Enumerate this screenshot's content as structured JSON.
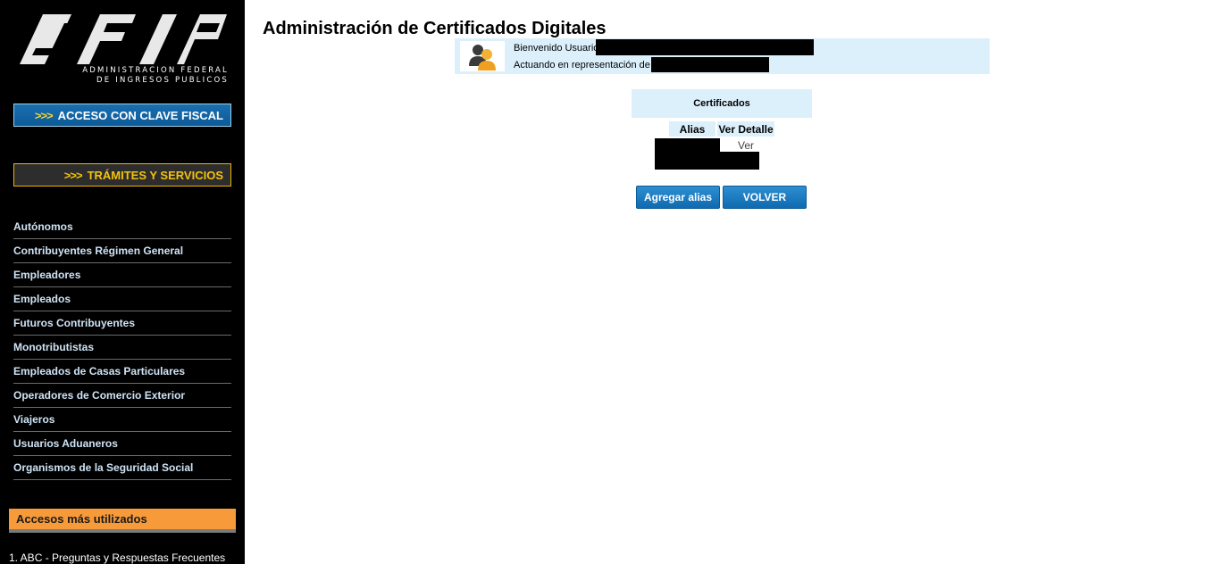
{
  "sidebar": {
    "logo": {
      "text": "AFIP",
      "subtitle_line1": "ADMINISTRACION FEDERAL",
      "subtitle_line2": "DE INGRESOS PUBLICOS"
    },
    "clave_fiscal": {
      "arrows": ">>>",
      "label": "ACCESO CON CLAVE FISCAL"
    },
    "tramites": {
      "arrows": ">>>",
      "label": "TRÁMITES Y SERVICIOS"
    },
    "nav_items": [
      "Autónomos",
      "Contribuyentes Régimen General",
      "Empleadores",
      "Empleados",
      "Futuros Contribuyentes",
      "Monotributistas",
      "Empleados de Casas Particulares",
      "Operadores de Comercio Exterior",
      "Viajeros",
      "Usuarios Aduaneros",
      "Organismos de la Seguridad Social"
    ],
    "accesos_title": "Accesos más utilizados",
    "faq_link": "1. ABC - Preguntas y Respuestas Frecuentes"
  },
  "main": {
    "title": "Administración de Certificados Digitales",
    "welcome": "Bienvenido Usuario",
    "acting": "Actuando en representación de",
    "certificates_title": "Certificados",
    "table": {
      "col_alias": "Alias",
      "col_detalle": "Ver Detalle",
      "row_link": "Ver"
    },
    "buttons": {
      "add_alias": "Agregar alias",
      "back": "VOLVER"
    }
  },
  "colors": {
    "sidebar_bg": "#000000",
    "accent_blue": "#0f6ab0",
    "light_blue_panel": "#dcf0fc",
    "tramites_gold": "#f4c20d",
    "accesos_orange": "#f79a3a"
  },
  "icons": {
    "user": "users-icon",
    "arrows": "triple-chevron-icon"
  }
}
